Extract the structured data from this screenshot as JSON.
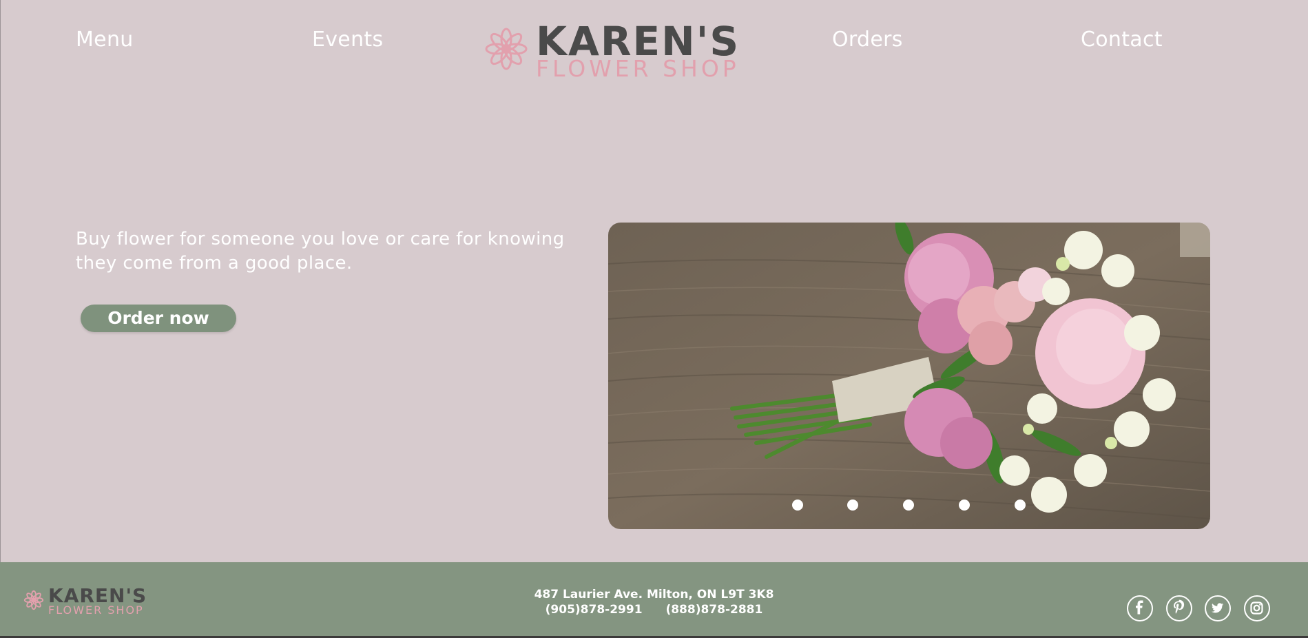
{
  "nav": {
    "items": [
      {
        "label": "Menu"
      },
      {
        "label": "Events"
      },
      {
        "label": "Orders"
      },
      {
        "label": "Contact"
      }
    ]
  },
  "logo": {
    "name": "KAREN'S",
    "sub": "FLOWER SHOP"
  },
  "hero": {
    "text": "Buy flower for someone you love or care for knowing\n they come from a good place.",
    "button_label": "Order now"
  },
  "slideshow": {
    "image": "pink-peony-bouquet",
    "slide_count": 5
  },
  "footer": {
    "address": "487 Laurier Ave. Milton, ON L9T 3K8",
    "phone_1": "(905)878-2991",
    "phone_2": "(888)878-2881",
    "social": [
      "facebook-icon",
      "pinterest-icon",
      "twitter-icon",
      "instagram-icon"
    ]
  },
  "colors": {
    "background": "#d7cbce",
    "accent_green": "#849581",
    "button_green": "#7f927d",
    "logo_pink": "#e2a0ad",
    "logo_gray": "#4a4a4a"
  }
}
